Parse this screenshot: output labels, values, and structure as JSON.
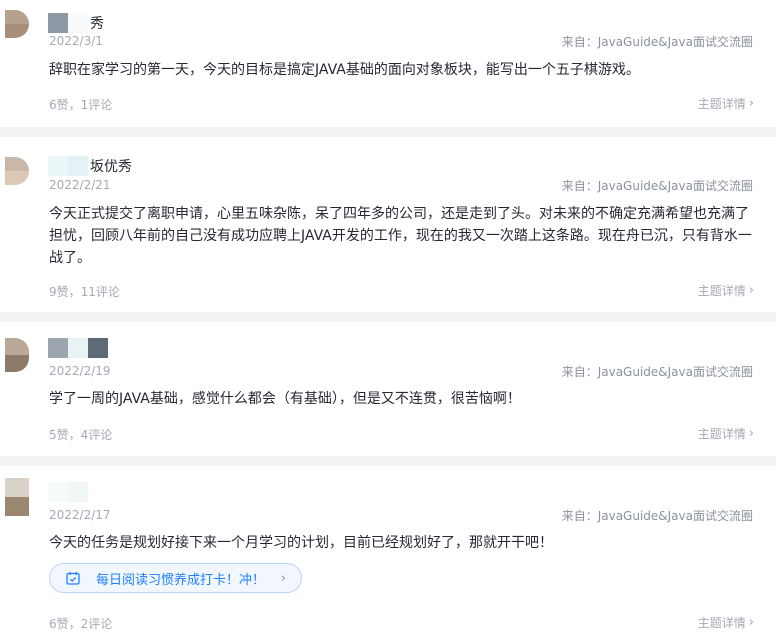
{
  "posts": [
    {
      "author_suffix": "秀",
      "date": "2022/3/1",
      "source": "来自：JavaGuide&Java面试交流圈",
      "content": "辞职在家学习的第一天，今天的目标是搞定JAVA基础的面向对象板块，能写出一个五子棋游戏。",
      "stats": "6赞，1评论",
      "detail": "主题详情",
      "avatar_colors": [
        "#b6a08e",
        "#a88f7b"
      ]
    },
    {
      "author_suffix": "坂优秀",
      "date": "2022/2/21",
      "source": "来自：JavaGuide&Java面试交流圈",
      "content": "今天正式提交了离职申请，心里五味杂陈，呆了四年多的公司，还是走到了头。对未来的不确定充满希望也充满了担忧，回顾八年前的自己没有成功应聘上JAVA开发的工作，现在的我又一次踏上这条路。现在舟已沉，只有背水一战了。",
      "stats": "9赞，11评论",
      "detail": "主题详情",
      "avatar_colors": [
        "#c9b8a8",
        "#dcc8b4"
      ]
    },
    {
      "author_suffix": "",
      "date": "2022/2/19",
      "source": "来自：JavaGuide&Java面试交流圈",
      "content": "学了一周的JAVA基础，感觉什么都会（有基础），但是又不连贯，很苦恼啊！",
      "stats": "5赞，4评论",
      "detail": "主题详情",
      "avatar_colors": [
        "#b9a797",
        "#8e7a6a"
      ]
    },
    {
      "author_suffix": "",
      "date": "2022/2/17",
      "source": "来自：JavaGuide&Java面试交流圈",
      "content": "今天的任务是规划好接下来一个月学习的计划，目前已经规划好了，那就开干吧！",
      "stats": "6赞，2评论",
      "detail": "主题详情",
      "avatar_colors": [
        "#d9d2c8",
        "#9b8770"
      ],
      "checkin": "每日阅读习惯养成打卡！冲！"
    }
  ],
  "colors": {
    "accent": "#1e80ff",
    "muted": "#a4a9b3",
    "divider": "#f2f3f5"
  }
}
